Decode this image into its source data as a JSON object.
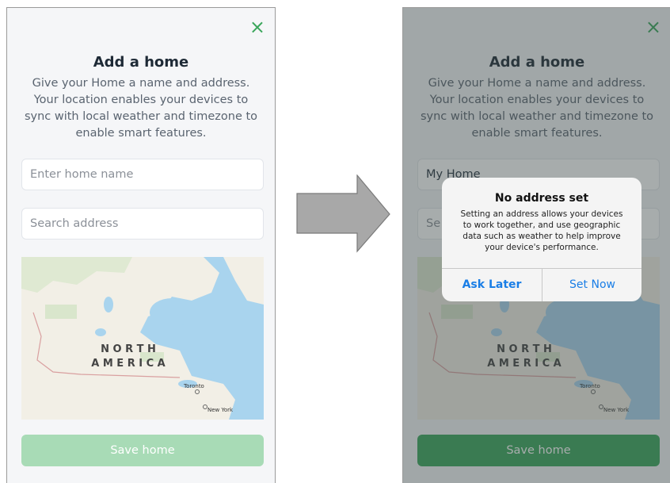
{
  "before": {
    "close_icon": "×",
    "title": "Add a home",
    "subtitle_lines": [
      "Give your Home a name and address.",
      "Your location enables your devices to",
      "sync with local weather and timezone to",
      "enable smart features."
    ],
    "home_name": {
      "value": "",
      "placeholder": "Enter home name"
    },
    "address": {
      "value": "",
      "placeholder": "Search address"
    },
    "map": {
      "region_line1": "N O R T H",
      "region_line2": "A M E R I C A",
      "city1": "Toronto",
      "city2": "New York"
    },
    "save_label": "Save home",
    "save_state": "disabled"
  },
  "after": {
    "close_icon": "×",
    "title": "Add a home",
    "subtitle_lines": [
      "Give your Home a name and address.",
      "Your location enables your devices to",
      "sync with local weather and timezone to",
      "enable smart features."
    ],
    "home_name": {
      "value": "My Home",
      "placeholder": "Enter home name"
    },
    "address": {
      "value": "Se",
      "placeholder": "Search address"
    },
    "map": {
      "region_line1": "N O R T H",
      "region_line2": "A M E R I C A",
      "city1": "Toronto",
      "city2": "New York"
    },
    "save_label": "Save home",
    "save_state": "enabled"
  },
  "dialog": {
    "title": "No address set",
    "message_lines": [
      "Setting an address allows your devices",
      "to work together, and use geographic",
      "data such as weather to help improve",
      "your device's performance."
    ],
    "ask_later_label": "Ask Later",
    "set_now_label": "Set Now"
  },
  "colors": {
    "accent_green": "#3aa65b",
    "disabled_green": "#a8dbb6",
    "link_blue": "#1a7ee6",
    "water": "#a9d4ee",
    "land": "#f2efe6"
  },
  "transition_arrow_icon": "right-arrow-icon"
}
